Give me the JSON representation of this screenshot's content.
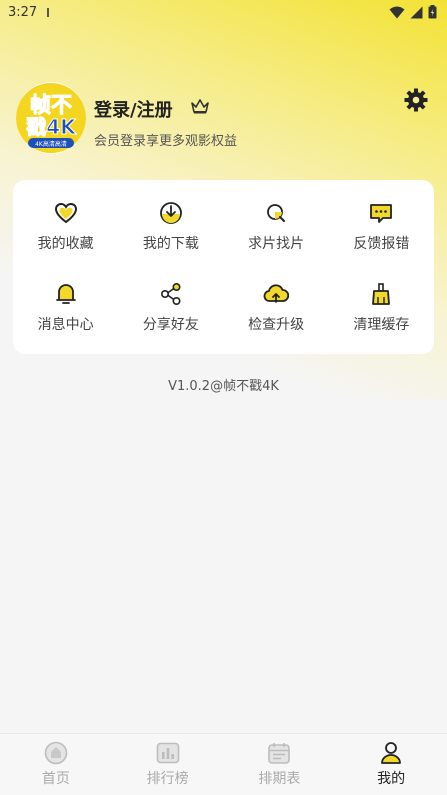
{
  "status_bar": {
    "time": "3:27"
  },
  "profile": {
    "title": "登录/注册",
    "subtitle": "会员登录享更多观影权益",
    "avatar_text_top": "帧不",
    "avatar_text_bottom": "戳4K",
    "avatar_tag": "4K高清高清"
  },
  "functions": [
    {
      "label": "我的收藏",
      "icon": "heart-icon"
    },
    {
      "label": "我的下载",
      "icon": "download-icon"
    },
    {
      "label": "求片找片",
      "icon": "search-movie-icon"
    },
    {
      "label": "反馈报错",
      "icon": "feedback-icon"
    },
    {
      "label": "消息中心",
      "icon": "bell-icon"
    },
    {
      "label": "分享好友",
      "icon": "share-icon"
    },
    {
      "label": "检查升级",
      "icon": "cloud-upload-icon"
    },
    {
      "label": "清理缓存",
      "icon": "broom-icon"
    }
  ],
  "version": "V1.0.2@帧不戳4K",
  "nav": [
    {
      "label": "首页",
      "icon": "home-icon",
      "active": false
    },
    {
      "label": "排行榜",
      "icon": "chart-icon",
      "active": false
    },
    {
      "label": "排期表",
      "icon": "calendar-icon",
      "active": false
    },
    {
      "label": "我的",
      "icon": "profile-icon",
      "active": true
    }
  ],
  "colors": {
    "accent": "#f2d82a",
    "gradient_top": "#f3e234"
  }
}
